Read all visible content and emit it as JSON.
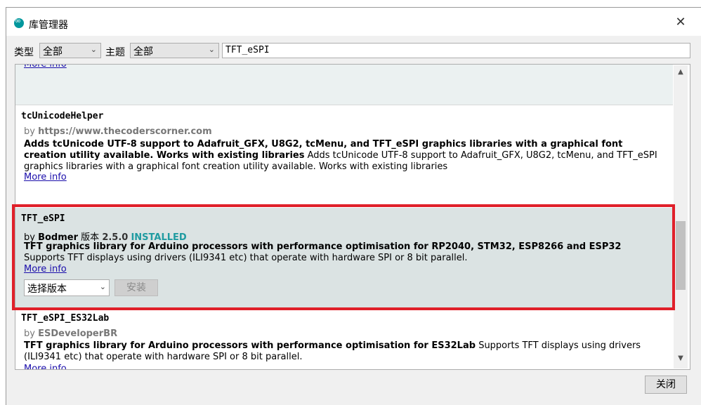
{
  "window": {
    "title": "库管理器"
  },
  "filters": {
    "type_label": "类型",
    "type_value": "全部",
    "topic_label": "主题",
    "topic_value": "全部",
    "search_value": "TFT_eSPI"
  },
  "libraries": [
    {
      "more_info": "More info"
    },
    {
      "name": "tcUnicodeHelper",
      "by_prefix": "by",
      "author": "https://www.thecoderscorner.com",
      "desc_bold": "Adds tcUnicode UTF-8 support to Adafruit_GFX, U8G2, tcMenu, and TFT_eSPI graphics libraries with a graphical font creation utility available. Works with existing libraries",
      "desc_rest": "Adds tcUnicode UTF-8 support to Adafruit_GFX, U8G2, tcMenu, and TFT_eSPI graphics libraries with a graphical font creation utility available. Works with existing libraries",
      "more_info": "More info"
    },
    {
      "name": "TFT_eSPI",
      "by_prefix": "by",
      "author": "Bodmer",
      "version_label": "版本",
      "version": "2.5.0",
      "status": "INSTALLED",
      "desc_bold": "TFT graphics library for Arduino processors with performance optimisation for RP2040, STM32, ESP8266 and ESP32",
      "desc_rest": "Supports TFT displays using drivers (ILI9341 etc) that operate with hardware SPI or 8 bit parallel.",
      "more_info": "More info",
      "version_select": "选择版本",
      "install_button": "安装"
    },
    {
      "name": "TFT_eSPI_ES32Lab",
      "by_prefix": "by",
      "author": "ESDeveloperBR",
      "desc_bold": "TFT graphics library for Arduino processors with performance optimisation for ES32Lab",
      "desc_rest": "Supports TFT displays using drivers (ILI9341 etc) that operate with hardware SPI or 8 bit parallel.",
      "more_info": "More info"
    }
  ],
  "footer": {
    "close_label": "关闭"
  },
  "colors": {
    "highlight": "#e0202a",
    "installed": "#1f9ba1",
    "selected_bg": "#dbe3e3"
  }
}
